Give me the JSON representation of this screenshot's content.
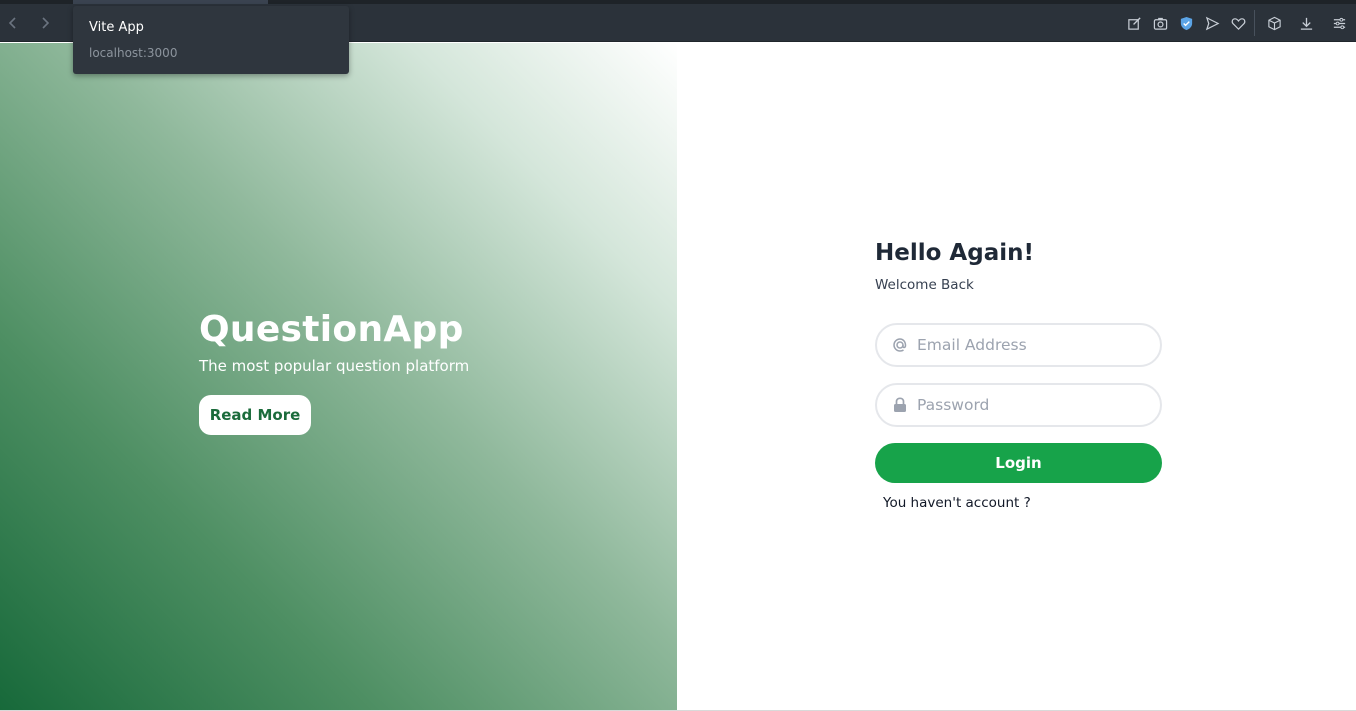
{
  "browser": {
    "tab_tooltip": {
      "title": "Vite App",
      "url": "localhost:3000"
    },
    "toolbar_icons": [
      "back-icon",
      "forward-icon",
      "edit-icon",
      "camera-icon",
      "shield-icon",
      "send-icon",
      "heart-icon",
      "cube-icon",
      "download-icon",
      "menu-icon"
    ],
    "accent_color": "#5ba4e6"
  },
  "hero": {
    "title": "QuestionApp",
    "subtitle": "The most popular question platform",
    "read_more_label": "Read More",
    "gradient_colors": [
      "#17693a",
      "#ffffff"
    ]
  },
  "login": {
    "heading": "Hello Again!",
    "subheading": "Welcome Back",
    "email_placeholder": "Email Address",
    "email_value": "",
    "password_placeholder": "Password",
    "password_value": "",
    "login_label": "Login",
    "signup_link": "You haven't account ?",
    "button_color": "#17a34a"
  }
}
